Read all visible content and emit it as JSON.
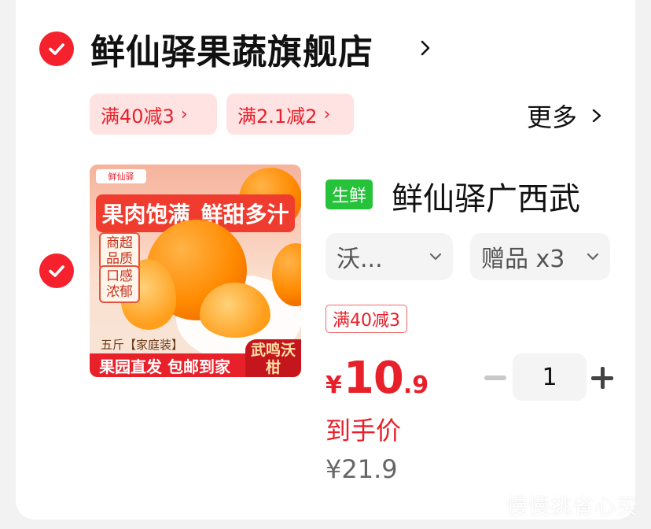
{
  "store": {
    "name": "鲜仙驿果蔬旗舰店",
    "checked": true,
    "chevron_icon": "chevron-right-icon"
  },
  "coupons": [
    {
      "label": "满40减3",
      "chev": "›"
    },
    {
      "label": "满2.1减2",
      "chev": "›"
    }
  ],
  "more": {
    "label": "更多"
  },
  "product": {
    "checked": true,
    "image": {
      "logo_text": "鲜仙驿",
      "banner_top_left": "果肉饱满",
      "banner_top_right": "鲜甜多汁",
      "tag_1": "商超品质",
      "tag_2": "口感浓郁",
      "small_text": "五斤【家庭装】",
      "banner_bottom": "果园直发 包邮到家",
      "corner": "武鸣沃柑"
    },
    "badge": "生鲜",
    "title": "鲜仙驿广西武",
    "sku_variant": "沃...",
    "sku_gift": "赠品 x3",
    "promo_tag": "满40减3",
    "price": {
      "currency": "¥",
      "integer": "10",
      "decimal": ".9"
    },
    "price_label": "到手价",
    "original_price": "¥21.9",
    "quantity": "1"
  },
  "watermark": "慢慢挑省心买",
  "colors": {
    "accent_red": "#e8202a",
    "check_red": "#f5222d",
    "coupon_bg": "#ffe3e3",
    "fresh_green": "#25c23a"
  }
}
